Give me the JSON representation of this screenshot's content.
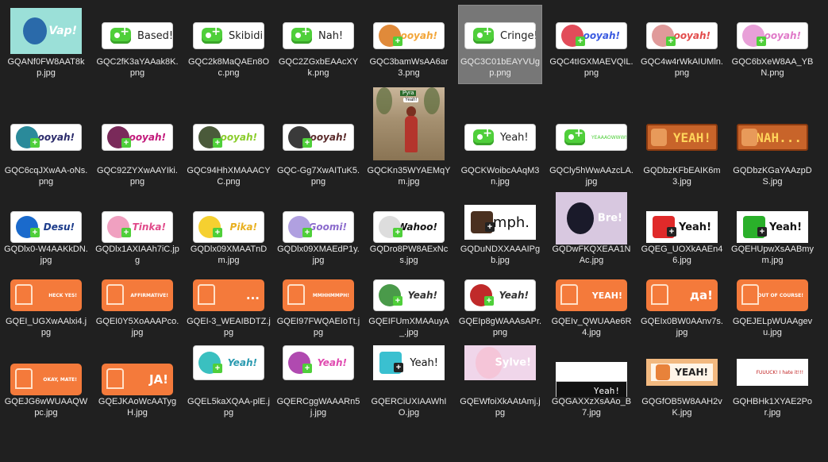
{
  "files": [
    {
      "name": "GQANf0FW8AAT8kp.jpg",
      "sticker": "teal",
      "text": "Vap!",
      "accent": "#9be0d8"
    },
    {
      "name": "GQC2fK3aYAAak8K.png",
      "sticker": "pill",
      "text": "Based!"
    },
    {
      "name": "GQC2k8MaQAEn8Oc.png",
      "sticker": "pill",
      "text": "Skibidi!"
    },
    {
      "name": "GQC2ZGxbEAAcXYk.png",
      "sticker": "pill",
      "text": "Nah!"
    },
    {
      "name": "GQC3bamWsAA6ar3.png",
      "sticker": "pillchar",
      "text": "Booyah!",
      "accent": "#f2a63a",
      "charColor": "#e08a3a"
    },
    {
      "name": "GQC3C01bEAYVUgp.png",
      "sticker": "pill",
      "text": "Cringe!",
      "selected": true
    },
    {
      "name": "GQC4tIGXMAEVQIL.png",
      "sticker": "pillchar",
      "text": "Booyah!",
      "accent": "#3a5ae0",
      "charColor": "#e24c5a"
    },
    {
      "name": "GQC4w4rWkAIUMln.png",
      "sticker": "pillchar",
      "text": "Booyah!",
      "accent": "#e24c4c",
      "charColor": "#e09a9a"
    },
    {
      "name": "GQC6bXeW8AA_YBN.png",
      "sticker": "pillchar",
      "text": "Booyah!",
      "accent": "#e07ac8",
      "charColor": "#e8a0d8"
    },
    {
      "name": "GQC6cqJXwAA-oNs.png",
      "sticker": "pillchar",
      "text": "Booyah!",
      "accent": "#2a2a6a",
      "charColor": "#2a8a9a"
    },
    {
      "name": "GQC92ZYXwAAYIki.png",
      "sticker": "pillchar",
      "text": "Booyah!",
      "accent": "#c2187a",
      "charColor": "#7a2a5a"
    },
    {
      "name": "GQC94HhXMAAACYC.png",
      "sticker": "pillchar",
      "text": "Booyah!",
      "accent": "#8acc2a",
      "charColor": "#4a5a3a"
    },
    {
      "name": "GQC-Gg7XwAITuK5.png",
      "sticker": "pillchar",
      "text": "Booyah!",
      "accent": "#5a2a2a",
      "charColor": "#3a3a3a"
    },
    {
      "name": "GQCKn35WYAEMqYm.jpg",
      "sticker": "photo",
      "text": "Yeah!"
    },
    {
      "name": "GQCKWoibcAAqM3n.jpg",
      "sticker": "pill",
      "text": "Yeah!"
    },
    {
      "name": "GQCly5hWwAAzcLA.jpg",
      "sticker": "pillsmall",
      "text": "YEAAAOWWW!"
    },
    {
      "name": "GQDbzKFbEAIK6m3.jpg",
      "sticker": "brick",
      "text": "YEAH!"
    },
    {
      "name": "GQDbzKGaYAAzpDS.jpg",
      "sticker": "brick",
      "text": "NAH..."
    },
    {
      "name": "GQDlx0-W4AAKkDN.jpg",
      "sticker": "pillchar",
      "text": "Desu!",
      "accent": "#1a3a8a",
      "charColor": "#1a6acc"
    },
    {
      "name": "GQDlx1AXIAAh7iC.jpg",
      "sticker": "pillchar",
      "text": "Tinka!",
      "accent": "#e04a8a",
      "charColor": "#f0a0c0"
    },
    {
      "name": "GQDlx09XMAATnDm.jpg",
      "sticker": "pillchar",
      "text": "Pika!",
      "accent": "#e8b020",
      "charColor": "#f5d030"
    },
    {
      "name": "GQDlx09XMAEdP1y.jpg",
      "sticker": "pillchar",
      "text": "Goomi!",
      "accent": "#8a6acc",
      "charColor": "#b0a0e0"
    },
    {
      "name": "GQDro8PW8AExNcs.jpg",
      "sticker": "pillchar",
      "text": "Wahoo!",
      "accent": "#111111",
      "charColor": "#dddddd"
    },
    {
      "name": "GQDuNDXXAAAIPgb.jpg",
      "sticker": "plainchar",
      "text": "Hmph.",
      "accent": "#111111",
      "charColor": "#4a3020"
    },
    {
      "name": "GQDwFKQXEAA1NAc.jpg",
      "sticker": "lilac",
      "text": "Bre!"
    },
    {
      "name": "GQEG_UOXkAAEn46.jpg",
      "sticker": "plainchar",
      "text": "Yeah!",
      "accent": "#111111",
      "charColor": "#e02a2a"
    },
    {
      "name": "GQEHUpwXsAABmym.jpg",
      "sticker": "plainchar",
      "text": "Yeah!",
      "accent": "#111111",
      "charColor": "#2ab02a"
    },
    {
      "name": "GQEI_UGXwAAlxi4.jpg",
      "sticker": "orange",
      "text": "HECK YES!"
    },
    {
      "name": "GQEI0Y5XoAAAPco.jpg",
      "sticker": "orange",
      "text": "AFFIRMATIVE!"
    },
    {
      "name": "GQEI-3_WEAIBDTZ.jpg",
      "sticker": "orange",
      "text": "..."
    },
    {
      "name": "GQEI97FWQAEIoTt.jpg",
      "sticker": "orange",
      "text": "MMHHMMPH!"
    },
    {
      "name": "GQEIFUmXMAAuyA_.jpg",
      "sticker": "pillchar",
      "text": "Yeah!",
      "accent": "#333333",
      "charColor": "#4a9a4a"
    },
    {
      "name": "GQEIp8gWAAAsAPr.png",
      "sticker": "pillchar",
      "text": "Yeah!",
      "accent": "#333333",
      "charColor": "#c02a2a"
    },
    {
      "name": "GQEIv_QWUAAe6R4.jpg",
      "sticker": "orange",
      "text": "YEAH!"
    },
    {
      "name": "GQEIx0BW0AAnv7s.jpg",
      "sticker": "orange",
      "text": "да!"
    },
    {
      "name": "GQEJELpWUAAgevu.jpg",
      "sticker": "orange",
      "text": "OUT OF COURSE!"
    },
    {
      "name": "GQEJG6wWUAAQWpc.jpg",
      "sticker": "orange",
      "text": "OKAY, MATE!"
    },
    {
      "name": "GQEJKAoWcAATygH.jpg",
      "sticker": "orange",
      "text": "JA!"
    },
    {
      "name": "GQEL5kaXQAA-plE.jpg",
      "sticker": "pillchar",
      "text": "Yeah!",
      "accent": "#2a9ab0",
      "charColor": "#3ac0c0"
    },
    {
      "name": "GQERCggWAAARn5j.jpg",
      "sticker": "pillchar",
      "text": "Yeah!",
      "accent": "#e04ab0",
      "charColor": "#b04ab0"
    },
    {
      "name": "GQERCiUXIAAWhIO.jpg",
      "sticker": "plainchar",
      "text": "Yeah!",
      "accent": "#222222",
      "charColor": "#3ac0d0"
    },
    {
      "name": "GQEWfoiXkAAtAmj.jpg",
      "sticker": "lilac",
      "text": "Sylve!"
    },
    {
      "name": "GQGAXXzXsAAo_B7.jpg",
      "sticker": "dark",
      "text": "Yeah!"
    },
    {
      "name": "GQGfOB5W8AAH2vK.jpg",
      "sticker": "tan",
      "text": "YEAH!"
    },
    {
      "name": "GQHBHk1XYAE2Por.jpg",
      "sticker": "plainsmall",
      "text": "FUUUCK! I hate it!!!"
    }
  ]
}
